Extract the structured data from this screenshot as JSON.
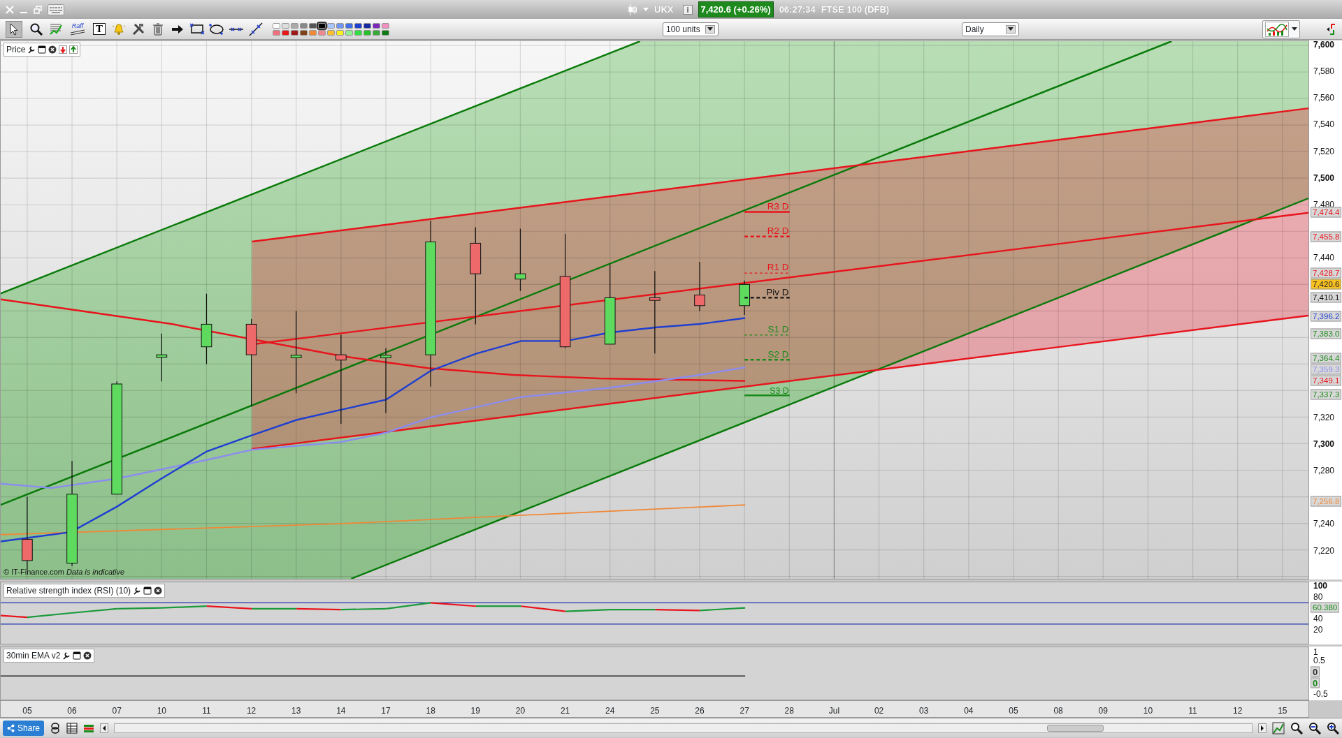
{
  "title_bar": {
    "symbol": "UKX",
    "info": "i",
    "price": "7,420.6 (+0.26%)",
    "time": "06:27:34",
    "instrument": "FTSE 100 (DFB)"
  },
  "toolbar": {
    "tools": [
      {
        "kind": "pointer",
        "selected": true
      },
      {
        "kind": "zoom",
        "selected": false
      },
      {
        "kind": "indicator",
        "selected": false
      },
      {
        "kind": "raff",
        "label": "Raff",
        "selected": false
      },
      {
        "kind": "text",
        "label": "T",
        "selected": false
      },
      {
        "kind": "alert",
        "selected": false
      },
      {
        "kind": "tools",
        "selected": false
      },
      {
        "kind": "delete",
        "selected": false
      },
      {
        "kind": "arrow",
        "selected": false
      },
      {
        "kind": "rectangle",
        "selected": false
      },
      {
        "kind": "ellipse",
        "selected": false
      },
      {
        "kind": "hline",
        "selected": false
      },
      {
        "kind": "line",
        "selected": false
      }
    ],
    "palette": [
      {
        "color": "#ffffff",
        "selected": false
      },
      {
        "color": "#dddddd",
        "selected": false
      },
      {
        "color": "#aaaaaa",
        "selected": false
      },
      {
        "color": "#888888",
        "selected": false
      },
      {
        "color": "#555555",
        "selected": false
      },
      {
        "color": "#000000",
        "selected": true
      },
      {
        "color": "#a9c4ff",
        "selected": false
      },
      {
        "color": "#6f95f5",
        "selected": false
      },
      {
        "color": "#3f6fe8",
        "selected": false
      },
      {
        "color": "#1f3fd0",
        "selected": false
      },
      {
        "color": "#1828a0",
        "selected": false
      },
      {
        "color": "#7a28b8",
        "selected": false
      },
      {
        "color": "#f090c0",
        "selected": false
      },
      {
        "color": "#f07080",
        "selected": false
      },
      {
        "color": "#e81818",
        "selected": false
      },
      {
        "color": "#a01818",
        "selected": false
      },
      {
        "color": "#804018",
        "selected": false
      },
      {
        "color": "#f08838",
        "selected": false
      },
      {
        "color": "#f08890",
        "selected": false
      },
      {
        "color": "#f8c030",
        "selected": false
      },
      {
        "color": "#f8f020",
        "selected": false
      },
      {
        "color": "#90f090",
        "selected": false
      },
      {
        "color": "#30e040",
        "selected": false
      },
      {
        "color": "#28c028",
        "selected": false
      },
      {
        "color": "#38a838",
        "selected": false
      },
      {
        "color": "#107810",
        "selected": false
      }
    ],
    "quantity": "100 units",
    "interval": "Daily"
  },
  "price_panel": {
    "title": "Price",
    "copyright": "© IT-Finance.com",
    "disclaimer": "Data is indicative",
    "pivots": [
      {
        "label": "R3 D",
        "color": "#e8141c"
      },
      {
        "label": "R2 D",
        "color": "#e8141c"
      },
      {
        "label": "R1 D",
        "color": "#e8141c"
      },
      {
        "label": "Piv D",
        "color": "#111111"
      },
      {
        "label": "S1 D",
        "color": "#1a8a1a"
      },
      {
        "label": "S2 D",
        "color": "#1a8a1a"
      },
      {
        "label": "S3 D",
        "color": "#1a8a1a"
      }
    ],
    "axis_labels": [
      {
        "text": "7,600",
        "major": true
      },
      {
        "text": "7,580",
        "major": false
      },
      {
        "text": "7,560",
        "major": false
      },
      {
        "text": "7,540",
        "major": false
      },
      {
        "text": "7,520",
        "major": false
      },
      {
        "text": "7,500",
        "major": true
      },
      {
        "text": "7,480",
        "major": false
      },
      {
        "text": "7,440",
        "major": false
      },
      {
        "text": "7,320",
        "major": false
      },
      {
        "text": "7,300",
        "major": true
      },
      {
        "text": "7,280",
        "major": false
      },
      {
        "text": "7,240",
        "major": false
      },
      {
        "text": "7,220",
        "major": false
      }
    ],
    "price_tags": [
      {
        "value": "7,474.4",
        "color": "#e8141c",
        "kind": "level"
      },
      {
        "value": "7,455.8",
        "color": "#e8141c",
        "kind": "level"
      },
      {
        "value": "7,428.7",
        "color": "#e8141c",
        "kind": "level"
      },
      {
        "value": "7,420.6",
        "kind": "current"
      },
      {
        "value": "7,410.1",
        "color": "#111111",
        "kind": "level"
      },
      {
        "value": "7,396.2",
        "color": "#1f3fd0",
        "kind": "level"
      },
      {
        "value": "7,383.0",
        "color": "#1a8a1a",
        "kind": "level"
      },
      {
        "value": "7,364.4",
        "color": "#1a8a1a",
        "kind": "level"
      },
      {
        "value": "7,359.3",
        "color": "#8c8cf0",
        "kind": "level"
      },
      {
        "value": "7,349.1",
        "color": "#e8141c",
        "kind": "level"
      },
      {
        "value": "7,337.3",
        "color": "#1a8a1a",
        "kind": "level"
      },
      {
        "value": "7,256.8",
        "color": "#f08838",
        "kind": "level"
      }
    ]
  },
  "rsi_panel": {
    "title": "Relative strength index (RSI) (10)",
    "axis_labels": [
      {
        "text": "100",
        "major": true
      },
      {
        "text": "80",
        "major": false
      },
      {
        "text": "40",
        "major": false
      },
      {
        "text": "20",
        "major": false
      }
    ],
    "price_tags": [
      {
        "value": "60.380",
        "color": "#1a8a1a"
      }
    ]
  },
  "ema_panel": {
    "title": "30min EMA v2",
    "axis_labels": [
      {
        "text": "1",
        "major": false
      },
      {
        "text": "0.5",
        "major": false
      },
      {
        "text": "-0.5",
        "major": false
      }
    ],
    "price_tags": [
      {
        "value": "0",
        "color": "#333333"
      },
      {
        "value": "0",
        "color": "#1a8a1a"
      }
    ]
  },
  "date_axis": [
    "05",
    "06",
    "07",
    "10",
    "11",
    "12",
    "13",
    "14",
    "17",
    "18",
    "19",
    "20",
    "21",
    "24",
    "25",
    "26",
    "27",
    "28",
    "Jul",
    "02",
    "03",
    "04",
    "05",
    "08",
    "09",
    "10",
    "11",
    "12",
    "15"
  ],
  "bottom_bar": {
    "share": "Share"
  }
}
